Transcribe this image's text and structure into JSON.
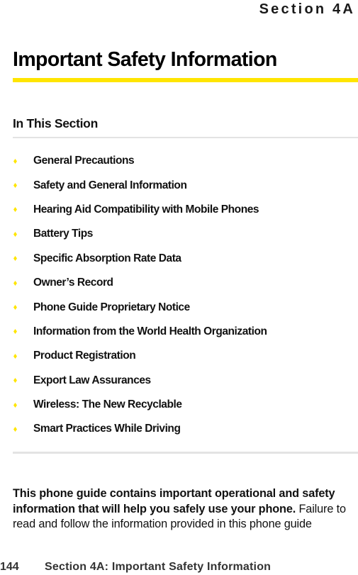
{
  "header": {
    "section_tag": "Section 4A"
  },
  "page": {
    "title": "Important Safety Information",
    "accent_color": "#ffe500"
  },
  "in_this_section": {
    "heading": "In This Section",
    "bullet_icon": "yellow-diamond",
    "items": [
      {
        "label": "General Precautions"
      },
      {
        "label": "Safety and General Information"
      },
      {
        "label": "Hearing Aid Compatibility with Mobile Phones"
      },
      {
        "label": "Battery Tips"
      },
      {
        "label": "Specific Absorption Rate Data"
      },
      {
        "label": "Owner’s Record"
      },
      {
        "label": "Phone Guide Proprietary Notice"
      },
      {
        "label": "Information from the World Health Organization"
      },
      {
        "label": "Product Registration"
      },
      {
        "label": "Export Law Assurances"
      },
      {
        "label": "Wireless: The New Recyclable"
      },
      {
        "label": "Smart Practices While Driving"
      }
    ]
  },
  "intro": {
    "bold_text": "This phone guide contains important operational and safety information that will help you safely use your phone.",
    "regular_text": " Failure to read and follow the information provided in this phone guide"
  },
  "footer": {
    "page_number": "144",
    "running_title": "Section 4A: Important Safety Information"
  }
}
